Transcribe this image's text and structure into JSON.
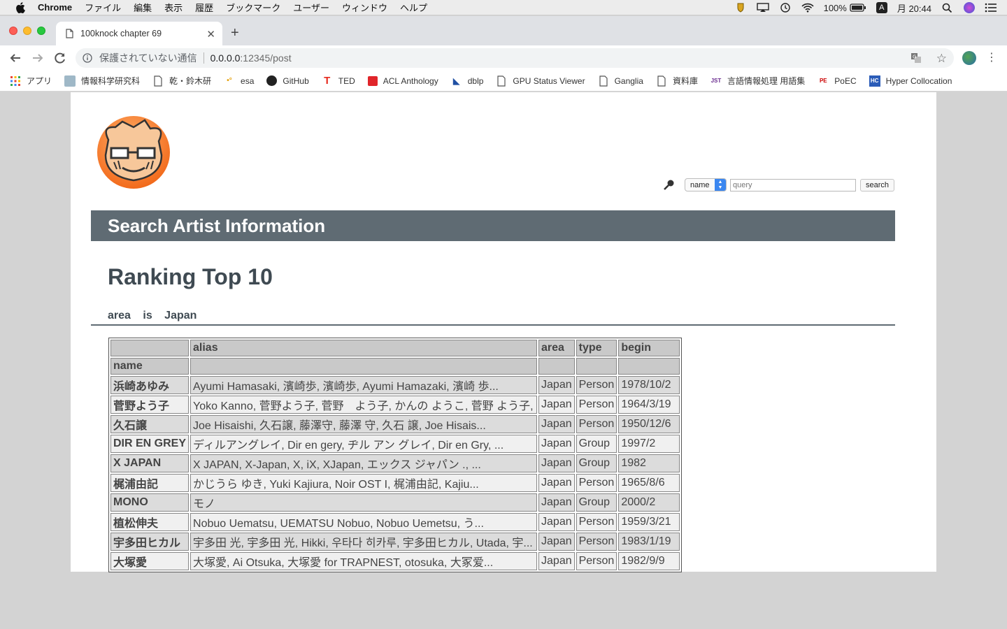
{
  "menubar": {
    "app_name": "Chrome",
    "items": [
      "ファイル",
      "編集",
      "表示",
      "履歴",
      "ブックマーク",
      "ユーザー",
      "ウィンドウ",
      "ヘルプ"
    ],
    "battery": "100%",
    "ime": "A",
    "clock": "月 20:44"
  },
  "browser": {
    "tab_title": "100knock chapter 69",
    "new_tab": "+",
    "security_label": "保護されていない通信",
    "url_host": "0.0.0.0",
    "url_path": ":12345/post"
  },
  "bookmarks": [
    {
      "label": "アプリ",
      "icon": "apps-grid-icon"
    },
    {
      "label": "情報科学研究科",
      "icon": "site-favicon"
    },
    {
      "label": "乾・鈴木研",
      "icon": "page-icon"
    },
    {
      "label": "esa",
      "icon": "esa-favicon"
    },
    {
      "label": "GitHub",
      "icon": "github-icon"
    },
    {
      "label": "TED",
      "icon": "ted-favicon"
    },
    {
      "label": "ACL Anthology",
      "icon": "acl-favicon"
    },
    {
      "label": "dblp",
      "icon": "dblp-favicon"
    },
    {
      "label": "GPU Status Viewer",
      "icon": "page-icon"
    },
    {
      "label": "Ganglia",
      "icon": "page-icon"
    },
    {
      "label": "資料庫",
      "icon": "page-icon"
    },
    {
      "label": "言語情報処理 用語集",
      "icon": "jaist-favicon"
    },
    {
      "label": "PoEC",
      "icon": "poec-favicon"
    },
    {
      "label": "Hyper Collocation",
      "icon": "hc-favicon"
    }
  ],
  "search": {
    "field_selected": "name",
    "query_placeholder": "query",
    "button_label": "search"
  },
  "page": {
    "banner_title": "Search Artist Information",
    "heading": "Ranking Top 10",
    "condition": {
      "field": "area",
      "op": "is",
      "value": "Japan"
    }
  },
  "table": {
    "columns": [
      "",
      "alias",
      "area",
      "type",
      "begin"
    ],
    "index_label": "name",
    "rows": [
      {
        "name": "浜崎あゆみ",
        "alias": "Ayumi Hamasaki, 濱崎歩, 濱崎歩, Ayumi Hamazaki, 濱崎 歩...",
        "area": "Japan",
        "type": "Person",
        "begin": "1978/10/2"
      },
      {
        "name": "菅野よう子",
        "alias": "Yoko Kanno, 菅野よう子, 菅野　よう子, かんの ようこ, 菅野 よう子, Yo...",
        "area": "Japan",
        "type": "Person",
        "begin": "1964/3/19"
      },
      {
        "name": "久石譲",
        "alias": "Joe Hisaishi, 久石譲, 藤澤守, 藤澤 守, 久石 譲, Joe Hisais...",
        "area": "Japan",
        "type": "Person",
        "begin": "1950/12/6"
      },
      {
        "name": "DIR EN GREY",
        "alias": "ディルアングレイ, Dir en gery, ヂル アン グレイ, Dir en Gry, ...",
        "area": "Japan",
        "type": "Group",
        "begin": "1997/2"
      },
      {
        "name": "X JAPAN",
        "alias": "X JAPAN, X-Japan, X, iX, XJapan, エックス ジャパン ., ...",
        "area": "Japan",
        "type": "Group",
        "begin": "1982"
      },
      {
        "name": "梶浦由記",
        "alias": "かじうら ゆき, Yuki Kajiura, Noir OST I, 梶浦由記, Kajiu...",
        "area": "Japan",
        "type": "Person",
        "begin": "1965/8/6"
      },
      {
        "name": "MONO",
        "alias": "モノ",
        "area": "Japan",
        "type": "Group",
        "begin": "2000/2"
      },
      {
        "name": "植松伸夫",
        "alias": "Nobuo Uematsu, UEMATSU Nobuo, Nobuo Uemetsu, う...",
        "area": "Japan",
        "type": "Person",
        "begin": "1959/3/21"
      },
      {
        "name": "宇多田ヒカル",
        "alias": "宇多田 光, 宇多田 光, Hikki, 우타다 히카루, 宇多田ヒカル, Utada, 宇...",
        "area": "Japan",
        "type": "Person",
        "begin": "1983/1/19"
      },
      {
        "name": "大塚愛",
        "alias": "大塚愛, Ai Otsuka, 大塚愛 for TRAPNEST, otosuka, 大冢爱...",
        "area": "Japan",
        "type": "Person",
        "begin": "1982/9/9"
      }
    ]
  }
}
